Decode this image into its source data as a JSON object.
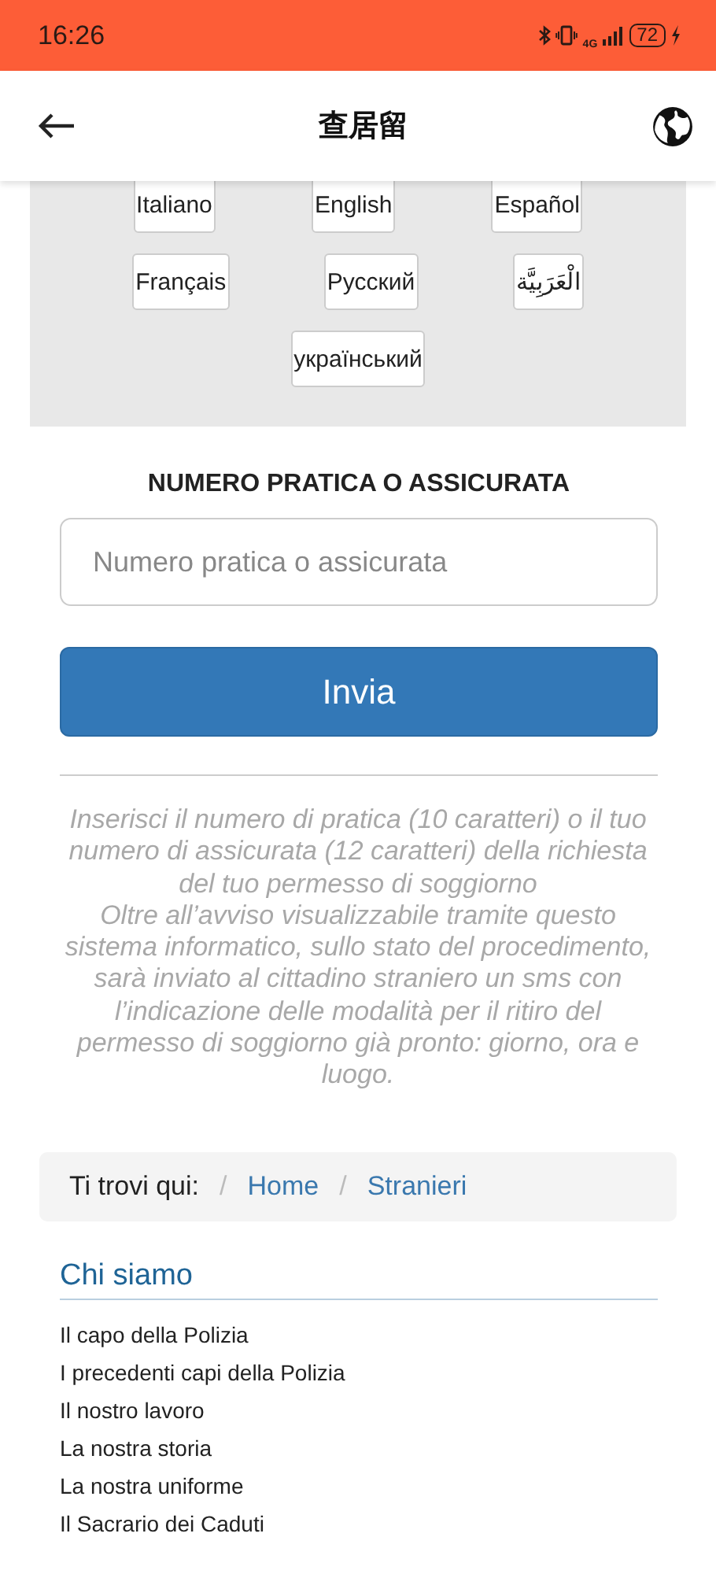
{
  "status_bar": {
    "time": "16:26",
    "network": "4G",
    "battery": "72"
  },
  "header": {
    "title": "查居留"
  },
  "languages": [
    [
      "Italiano",
      "English",
      "Español"
    ],
    [
      "Français",
      "Русский",
      "الْعَرَبِيَّة"
    ],
    [
      "український"
    ]
  ],
  "form": {
    "label": "NUMERO PRATICA O ASSICURATA",
    "placeholder": "Numero pratica o assicurata",
    "button": "Invia"
  },
  "info": "Inserisci il numero di pratica (10 caratteri) o il tuo numero di assicurata (12 caratteri) della richiesta del tuo permesso di soggiorno\nOltre all’avviso visualizzabile tramite questo sistema informatico, sullo stato del procedimento, sarà inviato al cittadino straniero un sms con l’indicazione delle modalità per il ritiro del permesso di soggiorno già pronto: giorno, ora e luogo.",
  "breadcrumb": [
    {
      "kind": "label",
      "text": "Ti trovi qui:"
    },
    {
      "kind": "separator",
      "text": "/"
    },
    {
      "kind": "link",
      "text": "Home"
    },
    {
      "kind": "separator",
      "text": "/"
    },
    {
      "kind": "link",
      "text": "Stranieri"
    }
  ],
  "section": {
    "title": "Chi siamo",
    "links": [
      "Il capo della Polizia",
      "I precedenti capi della Polizia",
      "Il nostro lavoro",
      "La nostra storia",
      "La nostra uniforme",
      "Il Sacrario dei Caduti"
    ]
  }
}
